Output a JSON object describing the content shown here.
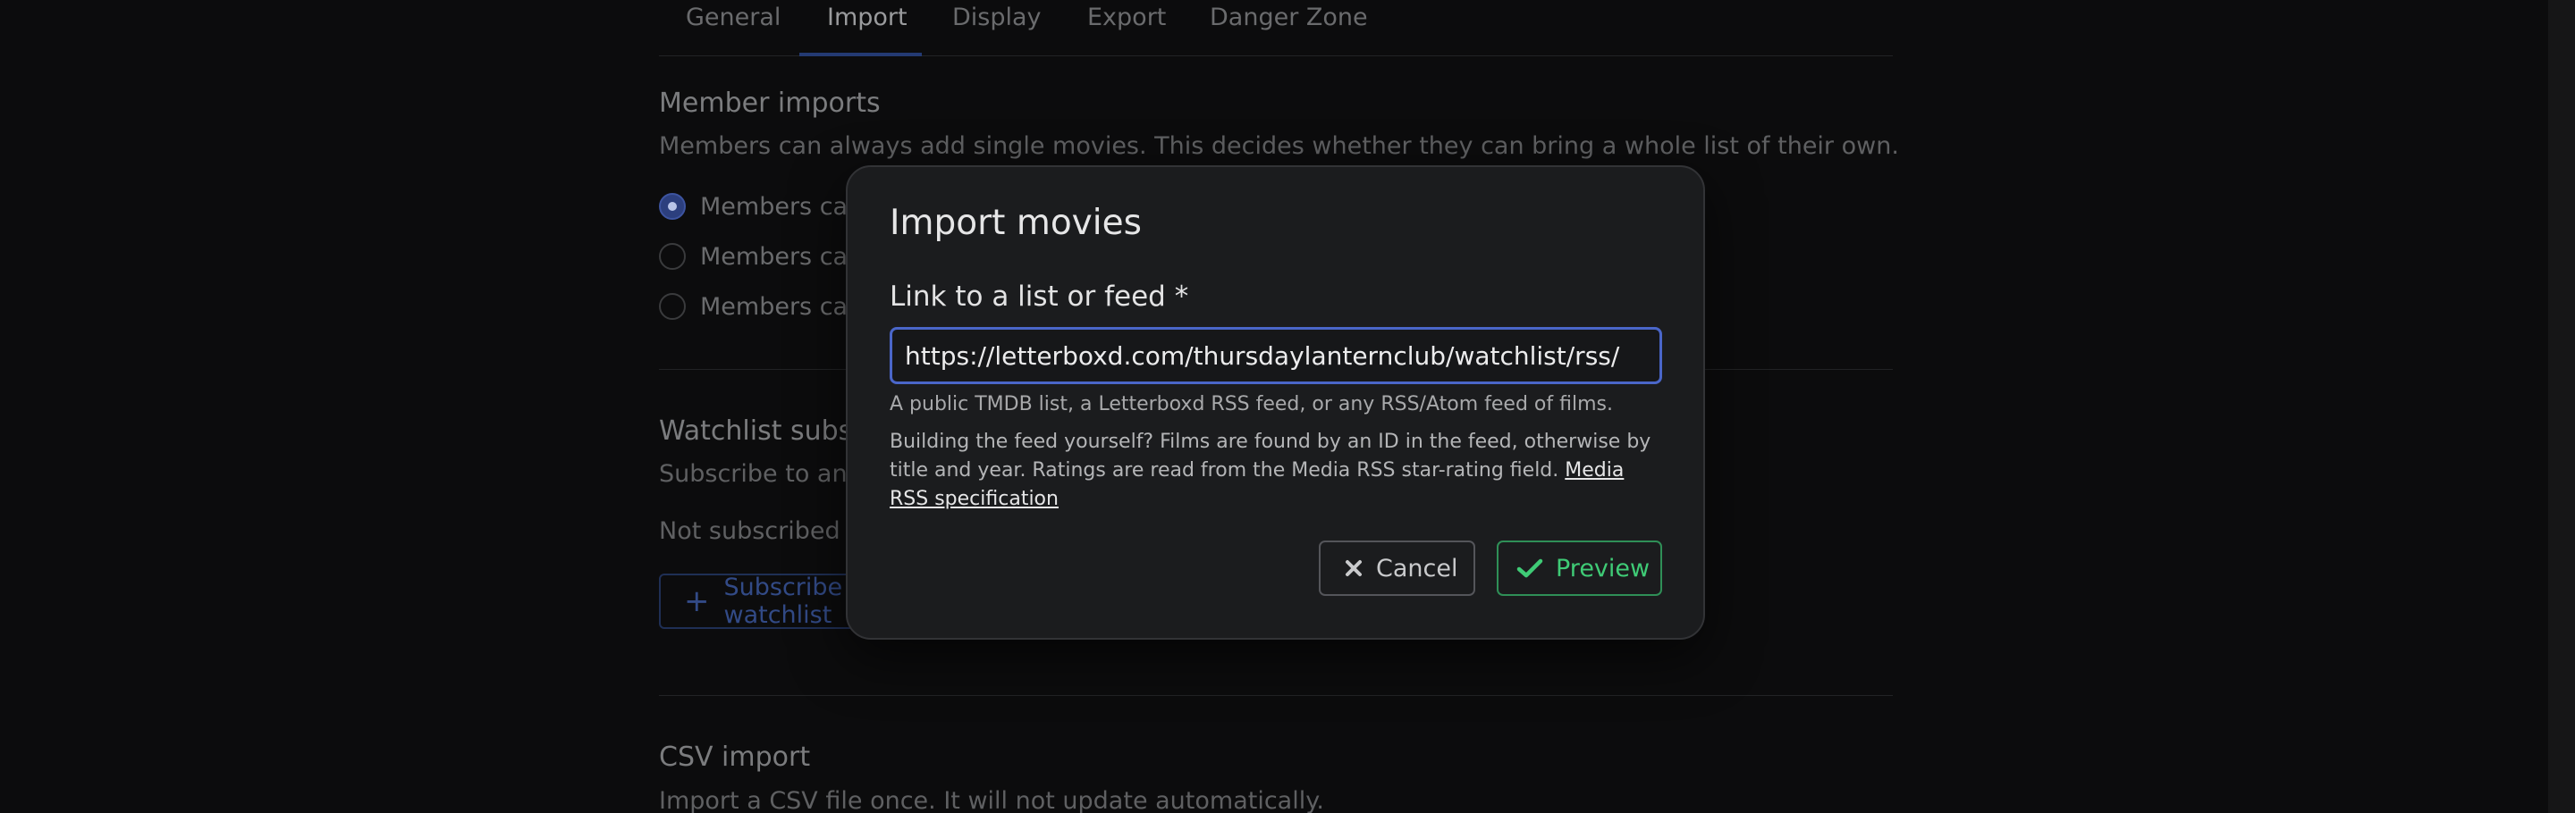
{
  "tabs": [
    {
      "label": "General"
    },
    {
      "label": "Import"
    },
    {
      "label": "Display"
    },
    {
      "label": "Export"
    },
    {
      "label": "Danger Zone"
    }
  ],
  "active_tab": "Import",
  "member_imports": {
    "title": "Member imports",
    "description": "Members can always add single movies. This decides whether they can bring a whole list of their own.",
    "options": [
      {
        "label": "Members can import their own lists and feeds",
        "checked": true
      },
      {
        "label": "Members can ask, and I approve each list",
        "checked": false
      },
      {
        "label": "Members cannot import lists",
        "checked": false
      }
    ]
  },
  "watchlist": {
    "title": "Watchlist subscriptions",
    "description": "Subscribe to another member's watchlist and new films will be added automatically.",
    "status": "Not subscribed to any watchlist yet.",
    "subscribe_label": "Subscribe to a watchlist"
  },
  "csv": {
    "title": "CSV import",
    "description": "Import a CSV file once. It will not update automatically."
  },
  "modal": {
    "title": "Import movies",
    "field_label": "Link to a list or feed *",
    "url_value": "https://letterboxd.com/thursdaylanternclub/watchlist/rss/",
    "help_short": "A public TMDB list, a Letterboxd RSS feed, or any RSS/Atom feed of films.",
    "help_long": "Building the feed yourself? Films are found by an ID in the feed, otherwise by title and year. Ratings are read from the Media RSS star-rating field. ",
    "help_link": "Media RSS specification",
    "cancel_label": "Cancel",
    "preview_label": "Preview"
  },
  "colors": {
    "accent": "#4a66c9",
    "success": "#3fcb76",
    "backdrop": "#0c0c0d"
  },
  "icons": {
    "cancel": "close-icon",
    "preview": "check-icon",
    "subscribe": "plus-icon"
  }
}
